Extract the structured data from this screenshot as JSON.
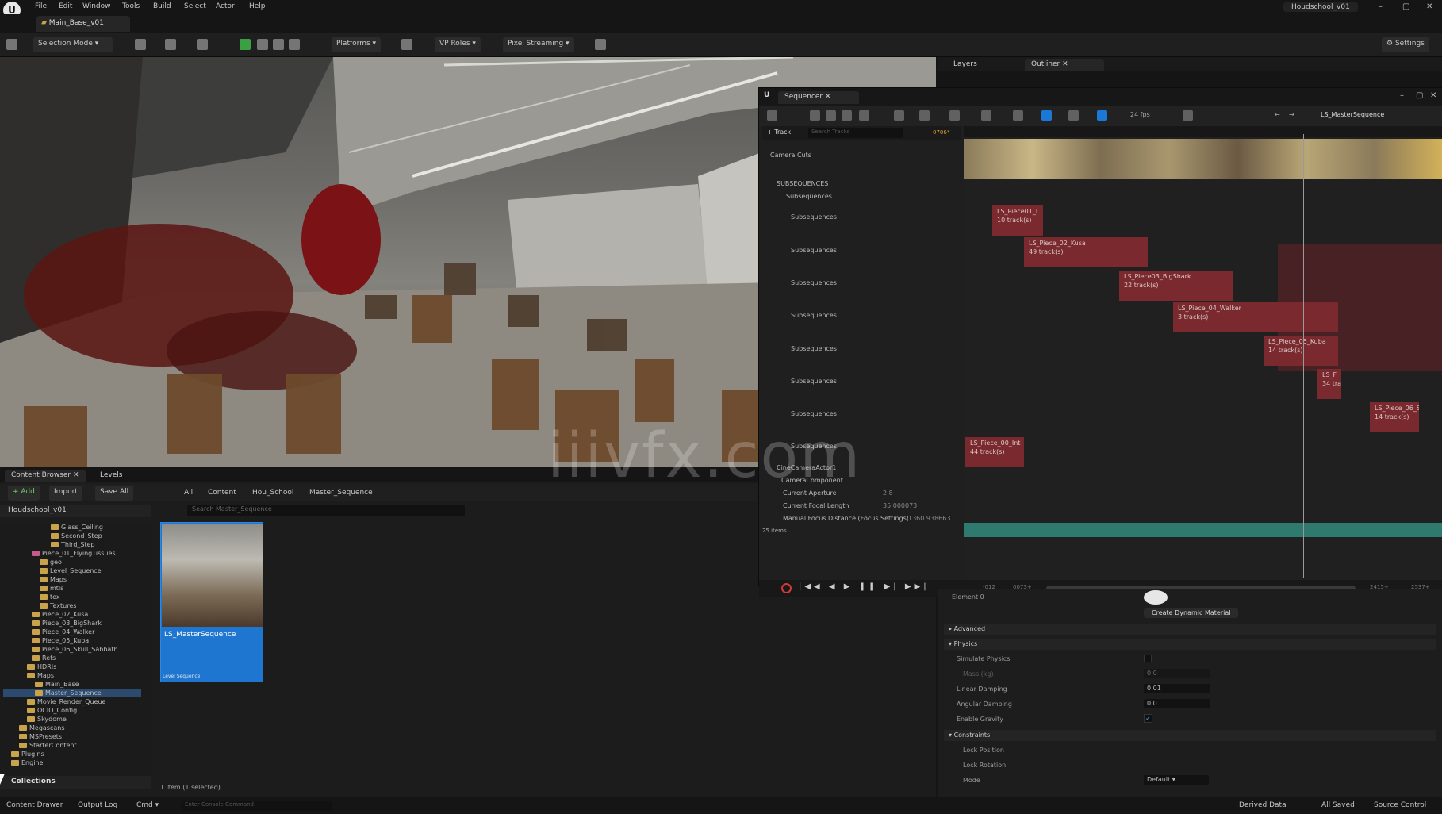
{
  "menubar": {
    "items": [
      "File",
      "Edit",
      "Window",
      "Tools",
      "Build",
      "Select",
      "Actor",
      "Help"
    ],
    "project": "Houdschool_v01"
  },
  "doc_tab": {
    "label": "Main_Base_v01"
  },
  "toolbar": {
    "mode": "Selection Mode",
    "platforms": "Platforms",
    "vp_roles": "VP Roles",
    "pixel_streaming": "Pixel Streaming",
    "settings": "Settings"
  },
  "panels": {
    "layers": "Layers",
    "outliner": "Outliner"
  },
  "sequencer": {
    "title": "Sequencer",
    "sequence_name": "LS_MasterSequence",
    "fps": "24 fps",
    "add_track": "+ Track",
    "search_placeholder": "Search Tracks",
    "current_frame": "0706*",
    "items_count": "25 items",
    "tracks": [
      "Camera Cuts",
      "SUBSEQUENCES",
      "Subsequences",
      "Subsequences",
      "Subsequences",
      "Subsequences",
      "Subsequences",
      "Subsequences",
      "Subsequences",
      "Subsequences",
      "Subsequences",
      "CineCameraActor1",
      "CameraComponent",
      "Current Aperture",
      "Current Focal Length",
      "Manual Focus Distance (Focus Settings)"
    ],
    "camera_values": {
      "aperture": "2.8",
      "focal": "35.000073",
      "focus": "1360.938663"
    },
    "sections": [
      {
        "name": "LS_Piece01_I",
        "tracks": "10 track(s)"
      },
      {
        "name": "LS_Piece_02_Kusa",
        "tracks": "49 track(s)"
      },
      {
        "name": "LS_Piece03_BigShark",
        "tracks": "22 track(s)"
      },
      {
        "name": "LS_Piece_04_Walker",
        "tracks": "3 track(s)"
      },
      {
        "name": "LS_Piece_05_Kuba",
        "tracks": "14 track(s)"
      },
      {
        "name": "LS_F",
        "tracks": "34 track(s)"
      },
      {
        "name": "LS_Piece_06_Sc",
        "tracks": "14 track(s)"
      },
      {
        "name": "LS_Piece_00_Int",
        "tracks": "44 track(s)"
      }
    ],
    "transport": {
      "start": "-012",
      "start_in": "0073+",
      "end_in": "2415+",
      "end": "2537+"
    }
  },
  "content_browser": {
    "tab": "Content Browser",
    "tab2": "Levels",
    "add": "+ Add",
    "import": "Import",
    "save_all": "Save All",
    "breadcrumb": [
      "All",
      "Content",
      "Hou_School",
      "Master_Sequence"
    ],
    "search_placeholder": "Search Master_Sequence",
    "root": "Houdschool_v01",
    "tree": [
      "Glass_Ceiling",
      "Second_Step",
      "Third_Step",
      "Piece_01_FlyingTissues",
      "geo",
      "Level_Sequence",
      "Maps",
      "mtls",
      "tex",
      "Textures",
      "Piece_02_Kusa",
      "Piece_03_BigShark",
      "Piece_04_Walker",
      "Piece_05_Kuba",
      "Piece_06_Skull_Sabbath",
      "Refs",
      "HDRIs",
      "Maps",
      "Main_Base",
      "Master_Sequence",
      "Movie_Render_Queue",
      "OCIO_Config",
      "Skydome",
      "Megascans",
      "MSPresets",
      "StarterContent",
      "Plugins",
      "Engine"
    ],
    "asset_name": "LS_MasterSequence",
    "asset_type": "Level Sequence",
    "status": "1 item (1 selected)",
    "collections": "Collections"
  },
  "details": {
    "element": "Element 0",
    "create_dynamic": "Create Dynamic Material",
    "advanced": "Advanced",
    "physics": "Physics",
    "props": [
      {
        "label": "Simulate Physics",
        "value": ""
      },
      {
        "label": "Mass (kg)",
        "value": "0.0"
      },
      {
        "label": "Linear Damping",
        "value": "0.01"
      },
      {
        "label": "Angular Damping",
        "value": "0.0"
      },
      {
        "label": "Enable Gravity",
        "value": "✓"
      }
    ],
    "constraints": "Constraints",
    "lock_position": "Lock Position",
    "lock_rotation": "Lock Rotation",
    "mode": "Mode",
    "mode_value": "Default"
  },
  "statusbar": {
    "drawer": "Content Drawer",
    "output_log": "Output Log",
    "cmd": "Cmd",
    "cmd_placeholder": "Enter Console Command",
    "derived": "Derived Data",
    "saved": "All Saved",
    "source": "Source Control"
  },
  "watermark": "iiivfx.com",
  "colors": {
    "accent": "#1e76d0",
    "section": "#7a2a2e",
    "play": "#3aa043"
  }
}
